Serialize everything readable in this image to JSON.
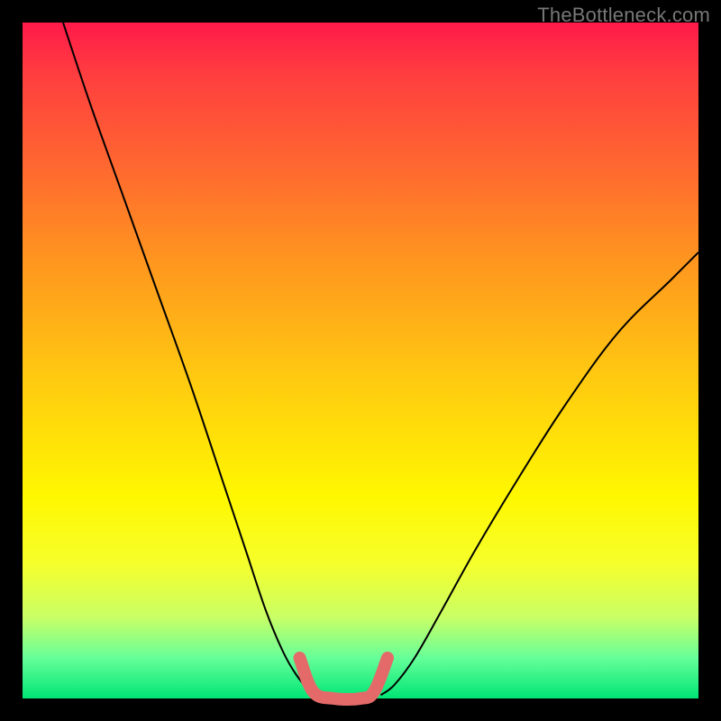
{
  "watermark": "TheBottleneck.com",
  "chart_data": {
    "type": "line",
    "title": "",
    "xlabel": "",
    "ylabel": "",
    "xlim": [
      0,
      100
    ],
    "ylim": [
      0,
      100
    ],
    "grid": false,
    "legend": false,
    "annotations": [],
    "series": [
      {
        "name": "left_curve",
        "x": [
          6,
          10,
          15,
          20,
          25,
          30,
          33,
          36,
          38.5,
          40.5,
          42.5,
          44
        ],
        "y": [
          100,
          88,
          74,
          60,
          46,
          31,
          22,
          13,
          7,
          3.5,
          1.2,
          0.5
        ]
      },
      {
        "name": "right_curve",
        "x": [
          53,
          55,
          58,
          62,
          67,
          73,
          80,
          88,
          96,
          100
        ],
        "y": [
          0.5,
          2,
          6,
          13,
          22,
          32,
          43,
          54,
          62,
          66
        ]
      },
      {
        "name": "valley_marker",
        "x": [
          41,
          43,
          46,
          50,
          52,
          54
        ],
        "y": [
          6,
          1,
          0,
          0,
          1,
          6
        ]
      }
    ],
    "background_gradient": {
      "top": "#ff1a4a",
      "mid": "#fff700",
      "bottom": "#00e676"
    }
  }
}
